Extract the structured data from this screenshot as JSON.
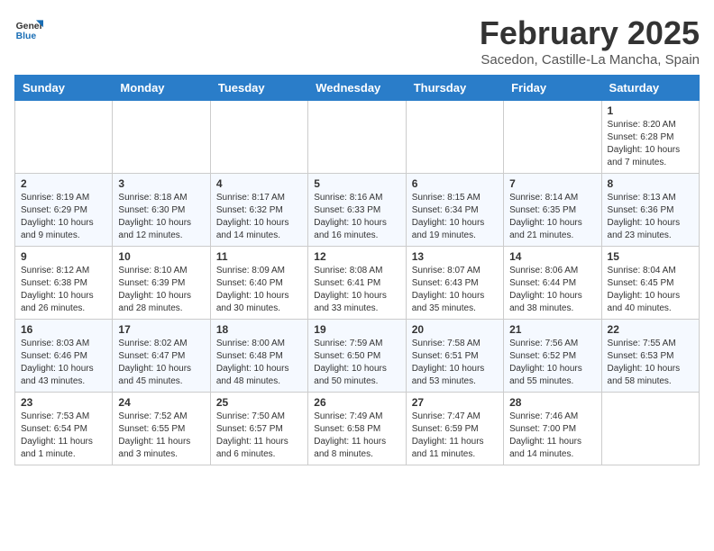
{
  "header": {
    "logo_general": "General",
    "logo_blue": "Blue",
    "month_title": "February 2025",
    "location": "Sacedon, Castille-La Mancha, Spain"
  },
  "weekdays": [
    "Sunday",
    "Monday",
    "Tuesday",
    "Wednesday",
    "Thursday",
    "Friday",
    "Saturday"
  ],
  "weeks": [
    [
      {
        "day": "",
        "info": ""
      },
      {
        "day": "",
        "info": ""
      },
      {
        "day": "",
        "info": ""
      },
      {
        "day": "",
        "info": ""
      },
      {
        "day": "",
        "info": ""
      },
      {
        "day": "",
        "info": ""
      },
      {
        "day": "1",
        "info": "Sunrise: 8:20 AM\nSunset: 6:28 PM\nDaylight: 10 hours\nand 7 minutes."
      }
    ],
    [
      {
        "day": "2",
        "info": "Sunrise: 8:19 AM\nSunset: 6:29 PM\nDaylight: 10 hours\nand 9 minutes."
      },
      {
        "day": "3",
        "info": "Sunrise: 8:18 AM\nSunset: 6:30 PM\nDaylight: 10 hours\nand 12 minutes."
      },
      {
        "day": "4",
        "info": "Sunrise: 8:17 AM\nSunset: 6:32 PM\nDaylight: 10 hours\nand 14 minutes."
      },
      {
        "day": "5",
        "info": "Sunrise: 8:16 AM\nSunset: 6:33 PM\nDaylight: 10 hours\nand 16 minutes."
      },
      {
        "day": "6",
        "info": "Sunrise: 8:15 AM\nSunset: 6:34 PM\nDaylight: 10 hours\nand 19 minutes."
      },
      {
        "day": "7",
        "info": "Sunrise: 8:14 AM\nSunset: 6:35 PM\nDaylight: 10 hours\nand 21 minutes."
      },
      {
        "day": "8",
        "info": "Sunrise: 8:13 AM\nSunset: 6:36 PM\nDaylight: 10 hours\nand 23 minutes."
      }
    ],
    [
      {
        "day": "9",
        "info": "Sunrise: 8:12 AM\nSunset: 6:38 PM\nDaylight: 10 hours\nand 26 minutes."
      },
      {
        "day": "10",
        "info": "Sunrise: 8:10 AM\nSunset: 6:39 PM\nDaylight: 10 hours\nand 28 minutes."
      },
      {
        "day": "11",
        "info": "Sunrise: 8:09 AM\nSunset: 6:40 PM\nDaylight: 10 hours\nand 30 minutes."
      },
      {
        "day": "12",
        "info": "Sunrise: 8:08 AM\nSunset: 6:41 PM\nDaylight: 10 hours\nand 33 minutes."
      },
      {
        "day": "13",
        "info": "Sunrise: 8:07 AM\nSunset: 6:43 PM\nDaylight: 10 hours\nand 35 minutes."
      },
      {
        "day": "14",
        "info": "Sunrise: 8:06 AM\nSunset: 6:44 PM\nDaylight: 10 hours\nand 38 minutes."
      },
      {
        "day": "15",
        "info": "Sunrise: 8:04 AM\nSunset: 6:45 PM\nDaylight: 10 hours\nand 40 minutes."
      }
    ],
    [
      {
        "day": "16",
        "info": "Sunrise: 8:03 AM\nSunset: 6:46 PM\nDaylight: 10 hours\nand 43 minutes."
      },
      {
        "day": "17",
        "info": "Sunrise: 8:02 AM\nSunset: 6:47 PM\nDaylight: 10 hours\nand 45 minutes."
      },
      {
        "day": "18",
        "info": "Sunrise: 8:00 AM\nSunset: 6:48 PM\nDaylight: 10 hours\nand 48 minutes."
      },
      {
        "day": "19",
        "info": "Sunrise: 7:59 AM\nSunset: 6:50 PM\nDaylight: 10 hours\nand 50 minutes."
      },
      {
        "day": "20",
        "info": "Sunrise: 7:58 AM\nSunset: 6:51 PM\nDaylight: 10 hours\nand 53 minutes."
      },
      {
        "day": "21",
        "info": "Sunrise: 7:56 AM\nSunset: 6:52 PM\nDaylight: 10 hours\nand 55 minutes."
      },
      {
        "day": "22",
        "info": "Sunrise: 7:55 AM\nSunset: 6:53 PM\nDaylight: 10 hours\nand 58 minutes."
      }
    ],
    [
      {
        "day": "23",
        "info": "Sunrise: 7:53 AM\nSunset: 6:54 PM\nDaylight: 11 hours\nand 1 minute."
      },
      {
        "day": "24",
        "info": "Sunrise: 7:52 AM\nSunset: 6:55 PM\nDaylight: 11 hours\nand 3 minutes."
      },
      {
        "day": "25",
        "info": "Sunrise: 7:50 AM\nSunset: 6:57 PM\nDaylight: 11 hours\nand 6 minutes."
      },
      {
        "day": "26",
        "info": "Sunrise: 7:49 AM\nSunset: 6:58 PM\nDaylight: 11 hours\nand 8 minutes."
      },
      {
        "day": "27",
        "info": "Sunrise: 7:47 AM\nSunset: 6:59 PM\nDaylight: 11 hours\nand 11 minutes."
      },
      {
        "day": "28",
        "info": "Sunrise: 7:46 AM\nSunset: 7:00 PM\nDaylight: 11 hours\nand 14 minutes."
      },
      {
        "day": "",
        "info": ""
      }
    ]
  ]
}
